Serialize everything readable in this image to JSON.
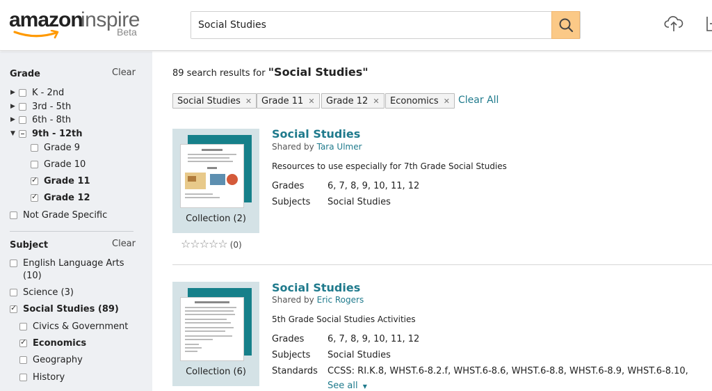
{
  "header": {
    "logo_amazon": "amazon",
    "logo_inspire": "inspire",
    "logo_beta": "Beta",
    "search_value": "Social Studies",
    "search_button_color": "#fbc987"
  },
  "sidebar": {
    "grade": {
      "title": "Grade",
      "clear": "Clear",
      "items": [
        {
          "label": "K - 2nd",
          "state": "unchecked",
          "expander": "right"
        },
        {
          "label": "3rd - 5th",
          "state": "unchecked",
          "expander": "right"
        },
        {
          "label": "6th - 8th",
          "state": "unchecked",
          "expander": "right"
        },
        {
          "label": "9th - 12th",
          "state": "partial",
          "expander": "down"
        },
        {
          "label": "Grade 9",
          "state": "unchecked"
        },
        {
          "label": "Grade 10",
          "state": "unchecked"
        },
        {
          "label": "Grade 11",
          "state": "checked"
        },
        {
          "label": "Grade 12",
          "state": "checked"
        },
        {
          "label": "Not Grade Specific",
          "state": "unchecked"
        }
      ]
    },
    "subject": {
      "title": "Subject",
      "clear": "Clear",
      "items": [
        {
          "label": "English Language Arts",
          "label_line2": "(10)",
          "state": "unchecked"
        },
        {
          "label": "Science (3)",
          "state": "unchecked"
        },
        {
          "label": "Social Studies (89)",
          "state": "checked"
        },
        {
          "label": "Civics & Government",
          "state": "unchecked"
        },
        {
          "label": "Economics",
          "state": "checked"
        },
        {
          "label": "Geography",
          "state": "unchecked"
        },
        {
          "label": "History",
          "state": "unchecked"
        }
      ]
    }
  },
  "results": {
    "count_text": "89 search results for",
    "query_text": "\"Social Studies\"",
    "chips": [
      "Social Studies",
      "Grade 11",
      "Grade 12",
      "Economics"
    ],
    "clear_all": "Clear All",
    "items": [
      {
        "title": "Social Studies",
        "shared_by_prefix": "Shared by",
        "shared_by": "Tara Ulmer",
        "description": "Resources to use especially for 7th Grade Social Studies",
        "collection_label": "Collection (2)",
        "rating_count": "(0)",
        "grades_label": "Grades",
        "grades": "6, 7, 8, 9, 10, 11, 12",
        "subjects_label": "Subjects",
        "subjects": "Social Studies"
      },
      {
        "title": "Social Studies",
        "shared_by_prefix": "Shared by",
        "shared_by": "Eric Rogers",
        "description": "5th Grade Social Studies Activities",
        "collection_label": "Collection (6)",
        "grades_label": "Grades",
        "grades": "6, 7, 8, 9, 10, 11, 12",
        "subjects_label": "Subjects",
        "subjects": "Social Studies",
        "standards_label": "Standards",
        "standards": "CCSS: RI.K.8, WHST.6-8.2.f, WHST.6-8.6, WHST.6-8.8, WHST.6-8.9, WHST.6-8.10,",
        "see_all": "See all"
      }
    ]
  },
  "colors": {
    "accent": "#1f7a8c",
    "sidebar_bg": "#eef0f3",
    "thumb_bg": "#d4e2e6",
    "thumb_teal": "#16808a"
  }
}
